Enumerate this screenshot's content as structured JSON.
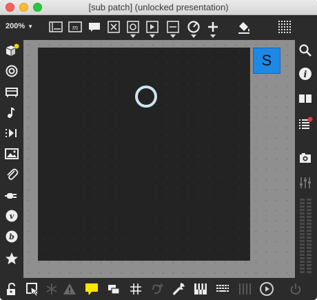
{
  "window": {
    "title": "[sub patch] (unlocked presentation)"
  },
  "toolbar": {
    "zoom": "200%",
    "icons": [
      "presentation-mode-icon",
      "comment-mode-icon",
      "message-icon",
      "bang-icon",
      "toggle-icon",
      "number-icon",
      "slider-icon",
      "dial-icon",
      "add-object-icon",
      "paint-bucket-icon",
      "grid-dots-icon"
    ]
  },
  "canvas": {
    "s_button_label": "S"
  },
  "colors": {
    "accent_blue": "#1e88e5",
    "notification_yellow": "#f5d000",
    "notification_red": "#e53935",
    "highlight_yellow": "#ffe500"
  }
}
